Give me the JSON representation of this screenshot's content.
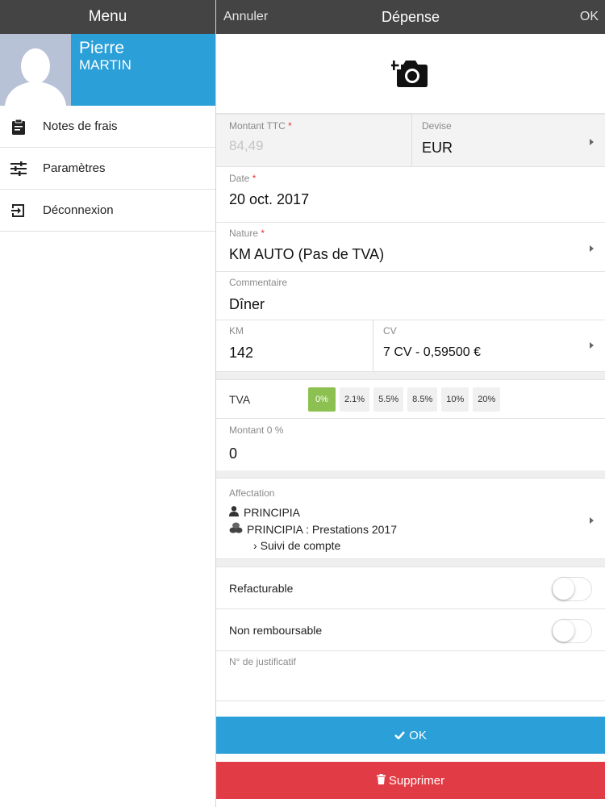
{
  "menu": {
    "title": "Menu",
    "user": {
      "first_name": "Pierre",
      "last_name": "MARTIN"
    },
    "items": [
      {
        "label": "Notes de frais",
        "icon": "clipboard-icon"
      },
      {
        "label": "Paramètres",
        "icon": "sliders-icon"
      },
      {
        "label": "Déconnexion",
        "icon": "logout-icon"
      }
    ]
  },
  "topbar": {
    "cancel": "Annuler",
    "title": "Dépense",
    "ok": "OK"
  },
  "form": {
    "amount": {
      "label": "Montant TTC",
      "required": "*",
      "placeholder": "84,49"
    },
    "devise": {
      "label": "Devise",
      "value": "EUR"
    },
    "date": {
      "label": "Date",
      "required": "*",
      "value": "20 oct. 2017"
    },
    "nature": {
      "label": "Nature",
      "required": "*",
      "value": "KM AUTO (Pas de TVA)"
    },
    "comment": {
      "label": "Commentaire",
      "value": "Dîner"
    },
    "km": {
      "label": "KM",
      "value": "142"
    },
    "cv": {
      "label": "CV",
      "value": "7 CV - 0,59500 €"
    },
    "tva": {
      "label": "TVA",
      "options": [
        "0%",
        "2.1%",
        "5.5%",
        "8.5%",
        "10%",
        "20%"
      ],
      "selected": "0%"
    },
    "amount_zero": {
      "label": "Montant 0 %",
      "value": "0"
    },
    "affectation": {
      "label": "Affectation",
      "client": "PRINCIPIA",
      "project": "PRINCIPIA : Prestations 2017",
      "task": "Suivi de compte"
    },
    "refacturable": {
      "label": "Refacturable",
      "on": false
    },
    "non_remboursable": {
      "label": "Non remboursable",
      "on": false
    },
    "justificatif": {
      "label": "N° de justificatif",
      "value": ""
    }
  },
  "buttons": {
    "ok": "OK",
    "delete": "Supprimer"
  },
  "colors": {
    "header": "#444444",
    "accent": "#2a9fd8",
    "danger": "#e13b45",
    "tva_active": "#8cc152"
  }
}
